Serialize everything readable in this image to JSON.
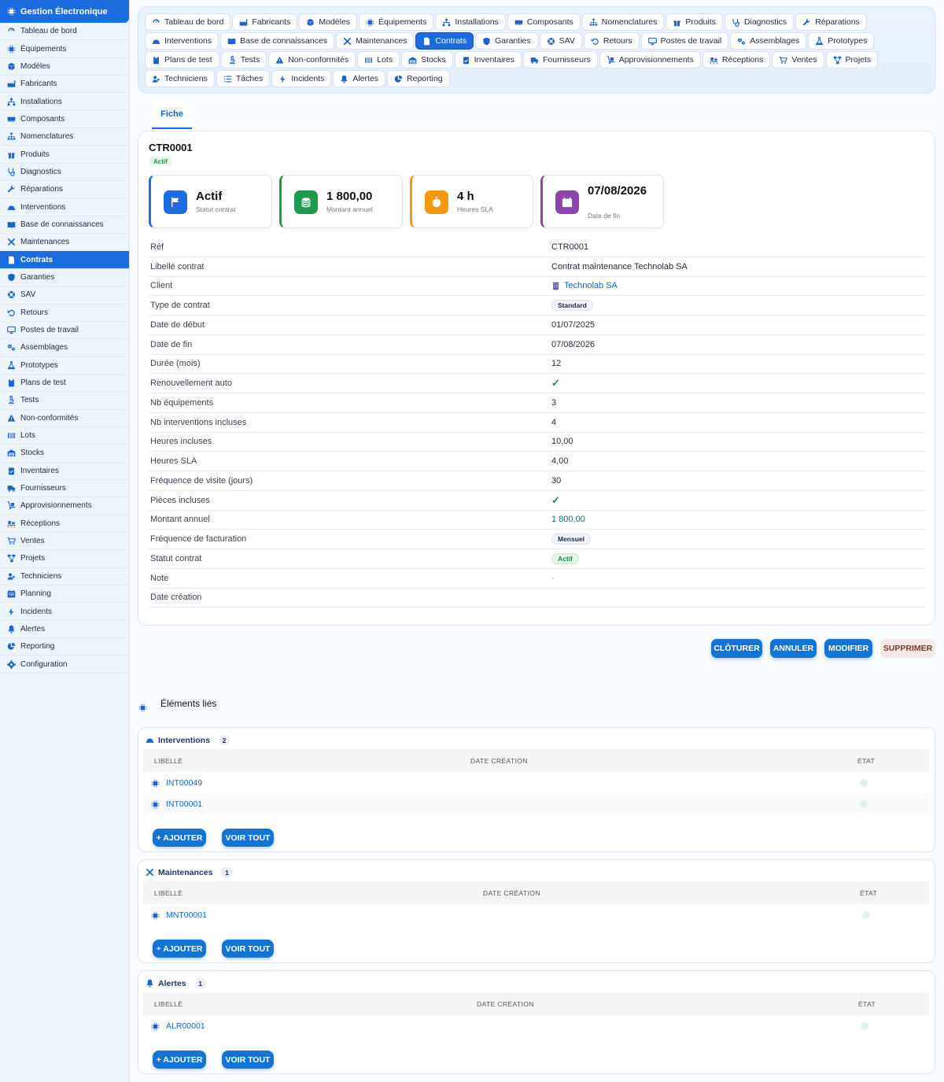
{
  "app": {
    "title": "Gestion Électronique"
  },
  "sidebar": {
    "items": [
      {
        "label": "Tableau de bord",
        "icon": "dashboard-icon"
      },
      {
        "label": "Équipements",
        "icon": "chip-icon"
      },
      {
        "label": "Modèles",
        "icon": "box-icon"
      },
      {
        "label": "Fabricants",
        "icon": "factory-icon"
      },
      {
        "label": "Installations",
        "icon": "network-icon"
      },
      {
        "label": "Composants",
        "icon": "memory-icon"
      },
      {
        "label": "Nomenclatures",
        "icon": "sitemap-icon"
      },
      {
        "label": "Produits",
        "icon": "gift-icon"
      },
      {
        "label": "Diagnostics",
        "icon": "stethoscope-icon"
      },
      {
        "label": "Réparations",
        "icon": "wrench-icon"
      },
      {
        "label": "Interventions",
        "icon": "helmet-icon"
      },
      {
        "label": "Base de connaissances",
        "icon": "book-icon"
      },
      {
        "label": "Maintenances",
        "icon": "tools-icon"
      },
      {
        "label": "Contrats",
        "icon": "document-icon"
      },
      {
        "label": "Garanties",
        "icon": "shield-icon"
      },
      {
        "label": "SAV",
        "icon": "lifebuoy-icon"
      },
      {
        "label": "Retours",
        "icon": "undo-icon"
      },
      {
        "label": "Postes de travail",
        "icon": "monitor-icon"
      },
      {
        "label": "Assemblages",
        "icon": "cogs-icon"
      },
      {
        "label": "Prototypes",
        "icon": "flask-icon"
      },
      {
        "label": "Plans de test",
        "icon": "clipboard-icon"
      },
      {
        "label": "Tests",
        "icon": "microscope-icon"
      },
      {
        "label": "Non-conformités",
        "icon": "warning-icon"
      },
      {
        "label": "Lots",
        "icon": "barcode-icon"
      },
      {
        "label": "Stocks",
        "icon": "warehouse-icon"
      },
      {
        "label": "Inventaires",
        "icon": "clipboard-check-icon"
      },
      {
        "label": "Fournisseurs",
        "icon": "truck-icon"
      },
      {
        "label": "Approvisionnements",
        "icon": "dolly-icon"
      },
      {
        "label": "Réceptions",
        "icon": "pallet-icon"
      },
      {
        "label": "Ventes",
        "icon": "cart-icon"
      },
      {
        "label": "Projets",
        "icon": "project-icon"
      },
      {
        "label": "Techniciens",
        "icon": "users-icon"
      },
      {
        "label": "Planning",
        "icon": "calendar-icon"
      },
      {
        "label": "Incidents",
        "icon": "bolt-icon"
      },
      {
        "label": "Alertes",
        "icon": "bell-icon"
      },
      {
        "label": "Reporting",
        "icon": "pie-chart-icon"
      },
      {
        "label": "Configuration",
        "icon": "gear-icon"
      }
    ],
    "active_index": 13
  },
  "toptabs": [
    {
      "label": "Tableau de bord",
      "icon": "dashboard-icon"
    },
    {
      "label": "Fabricants",
      "icon": "factory-icon"
    },
    {
      "label": "Modèles",
      "icon": "box-icon"
    },
    {
      "label": "Équipements",
      "icon": "chip-icon"
    },
    {
      "label": "Installations",
      "icon": "network-icon"
    },
    {
      "label": "Composants",
      "icon": "memory-icon"
    },
    {
      "label": "Nomenclatures",
      "icon": "sitemap-icon"
    },
    {
      "label": "Produits",
      "icon": "gift-icon"
    },
    {
      "label": "Diagnostics",
      "icon": "stethoscope-icon"
    },
    {
      "label": "Réparations",
      "icon": "wrench-icon"
    },
    {
      "label": "Interventions",
      "icon": "helmet-icon"
    },
    {
      "label": "Base de connaissances",
      "icon": "book-icon"
    },
    {
      "label": "Maintenances",
      "icon": "tools-icon"
    },
    {
      "label": "Contrats",
      "icon": "document-icon"
    },
    {
      "label": "Garanties",
      "icon": "shield-icon"
    },
    {
      "label": "SAV",
      "icon": "lifebuoy-icon"
    },
    {
      "label": "Retours",
      "icon": "undo-icon"
    },
    {
      "label": "Postes de travail",
      "icon": "monitor-icon"
    },
    {
      "label": "Assemblages",
      "icon": "cogs-icon"
    },
    {
      "label": "Prototypes",
      "icon": "flask-icon"
    },
    {
      "label": "Plans de test",
      "icon": "clipboard-icon"
    },
    {
      "label": "Tests",
      "icon": "microscope-icon"
    },
    {
      "label": "Non-conformités",
      "icon": "warning-icon"
    },
    {
      "label": "Lots",
      "icon": "barcode-icon"
    },
    {
      "label": "Stocks",
      "icon": "warehouse-icon"
    },
    {
      "label": "Inventaires",
      "icon": "clipboard-check-icon"
    },
    {
      "label": "Fournisseurs",
      "icon": "truck-icon"
    },
    {
      "label": "Approvisionnements",
      "icon": "dolly-icon"
    },
    {
      "label": "Réceptions",
      "icon": "pallet-icon"
    },
    {
      "label": "Ventes",
      "icon": "cart-icon"
    },
    {
      "label": "Projets",
      "icon": "project-icon"
    },
    {
      "label": "Techniciens",
      "icon": "users-icon"
    },
    {
      "label": "Tâches",
      "icon": "list-icon"
    },
    {
      "label": "Incidents",
      "icon": "bolt-icon"
    },
    {
      "label": "Alertes",
      "icon": "bell-icon"
    },
    {
      "label": "Reporting",
      "icon": "pie-chart-icon"
    }
  ],
  "toptabs_active_index": 13,
  "fiche_tab": {
    "label": "Fiche"
  },
  "record": {
    "ref": "CTR0001",
    "status": "Actif"
  },
  "kpis": [
    {
      "value": "Actif",
      "label": "Statut contrat",
      "icon": "flag-icon",
      "color": "#1d6be0"
    },
    {
      "value": "1 800,00",
      "label": "Montant annuel",
      "icon": "coins-icon",
      "color": "#1e9b4c"
    },
    {
      "value": "4 h",
      "label": "Heures SLA",
      "icon": "stopwatch-icon",
      "color": "#f29a0c"
    },
    {
      "value": "07/08/2026",
      "label": "Date de fin",
      "icon": "calendar-icon",
      "color": "#8e44ad"
    }
  ],
  "details": [
    {
      "key": "Réf",
      "value": "CTR0001",
      "type": "text"
    },
    {
      "key": "Libellé contrat",
      "value": "Contrat maintenance Technolab SA",
      "type": "text"
    },
    {
      "key": "Client",
      "value": "Technolab SA",
      "type": "link"
    },
    {
      "key": "Type de contrat",
      "value": "Standard",
      "type": "chip"
    },
    {
      "key": "Date de début",
      "value": "01/07/2025",
      "type": "text"
    },
    {
      "key": "Date de fin",
      "value": "07/08/2026",
      "type": "text"
    },
    {
      "key": "Durée (mois)",
      "value": "12",
      "type": "text"
    },
    {
      "key": "Renouvellement auto",
      "value": "✓",
      "type": "check"
    },
    {
      "key": "Nb équipements",
      "value": "3",
      "type": "text"
    },
    {
      "key": "Nb interventions incluses",
      "value": "4",
      "type": "text"
    },
    {
      "key": "Heures incluses",
      "value": "10,00",
      "type": "text"
    },
    {
      "key": "Heures SLA",
      "value": "4,00",
      "type": "text"
    },
    {
      "key": "Fréquence de visite (jours)",
      "value": "30",
      "type": "text"
    },
    {
      "key": "Pièces incluses",
      "value": "✓",
      "type": "check"
    },
    {
      "key": "Montant annuel",
      "value": "1 800,00",
      "type": "money"
    },
    {
      "key": "Fréquence de facturation",
      "value": "Mensuel",
      "type": "chip"
    },
    {
      "key": "Statut contrat",
      "value": "Actif",
      "type": "chip-green"
    },
    {
      "key": "Note",
      "value": "-",
      "type": "dash"
    },
    {
      "key": "Date création",
      "value": "",
      "type": "text"
    }
  ],
  "actions": {
    "close": "CLÔTURER",
    "cancel": "ANNULER",
    "edit": "MODIFIER",
    "delete": "SUPPRIMER"
  },
  "related": {
    "title": "Éléments liés",
    "columns": {
      "label": "LIBELLÉ",
      "date": "DATE CRÉATION",
      "state": "ÉTAT"
    },
    "add_label": "+ AJOUTER",
    "view_all_label": "VOIR TOUT",
    "sections": [
      {
        "title": "Interventions",
        "icon": "helmet-icon",
        "count": "2",
        "rows": [
          "INT00049",
          "INT00001"
        ]
      },
      {
        "title": "Maintenances",
        "icon": "tools-icon",
        "count": "1",
        "rows": [
          "MNT00001"
        ]
      },
      {
        "title": "Alertes",
        "icon": "bell-icon",
        "count": "1",
        "rows": [
          "ALR00001"
        ]
      }
    ]
  }
}
